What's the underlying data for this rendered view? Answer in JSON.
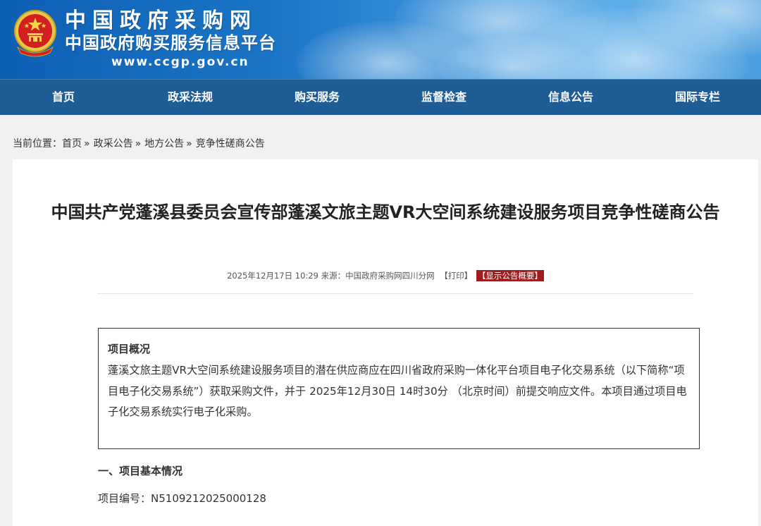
{
  "header": {
    "site_title": "中国政府采购网",
    "site_subtitle": "中国政府购买服务信息平台",
    "site_url": "www.ccgp.gov.cn",
    "emblem_icon": "national-emblem-icon",
    "bg_color": "#1a74c6"
  },
  "nav": {
    "items": [
      "首页",
      "政采法规",
      "购买服务",
      "监督检查",
      "信息公告",
      "国际专栏"
    ],
    "bg_color": "#1d5c95"
  },
  "breadcrumb": {
    "prefix": "当前位置：",
    "items": [
      "首页",
      "政采公告",
      "地方公告",
      "竞争性磋商公告"
    ],
    "separator": "»"
  },
  "article": {
    "title": "中国共产党蓬溪县委员会宣传部蓬溪文旅主题VR大空间系统建设服务项目竞争性磋商公告",
    "datetime": "2025年12月17日 10:29",
    "source_label": "来源：",
    "source": "中国政府采购网四川分网",
    "print_label": "【打印】",
    "summary_label": "【显示公告概要】",
    "summary_color": "#a01d1d",
    "overview": {
      "heading": "项目概况",
      "text": "蓬溪文旅主题VR大空间系统建设服务项目的潜在供应商应在四川省政府采购一体化平台项目电子化交易系统（以下简称“项目电子化交易系统”）获取采购文件，并于 2025年12月30日 14时30分 （北京时间）前提交响应文件。本项目通过项目电子化交易系统实行电子化采购。"
    },
    "section1_heading": "一、项目基本情况",
    "project_no_label": "项目编号：",
    "project_no": "N5109212025000128"
  }
}
